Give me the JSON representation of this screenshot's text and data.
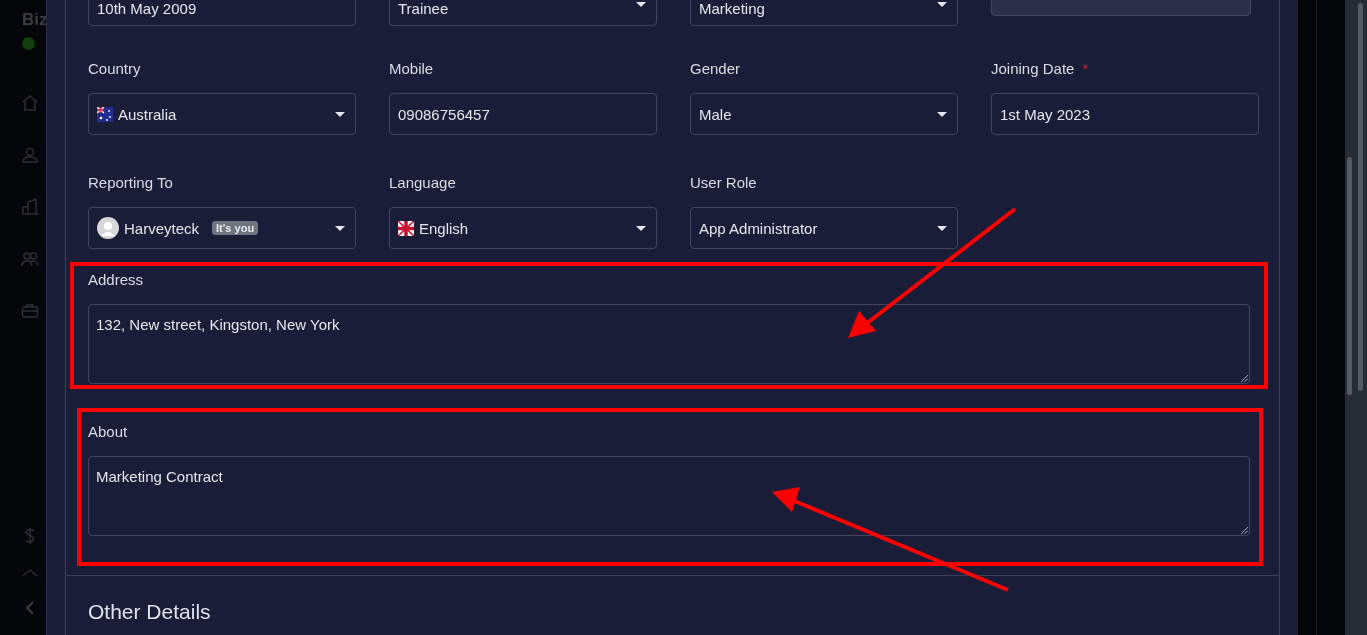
{
  "sidebar": {
    "brand": "Biz"
  },
  "top_row": [
    {
      "kind": "text",
      "value": "10th May 2009",
      "disabled": false
    },
    {
      "kind": "select",
      "value": "Trainee",
      "disabled": false
    },
    {
      "kind": "select",
      "value": "Marketing",
      "disabled": false
    },
    {
      "kind": "text",
      "disabled": true
    }
  ],
  "field_rows": [
    [
      {
        "label": "Country",
        "kind": "country",
        "value": "Australia"
      },
      {
        "label": "Mobile",
        "kind": "text",
        "value": "09086756457"
      },
      {
        "label": "Gender",
        "kind": "select",
        "value": "Male"
      },
      {
        "label": "Joining Date",
        "required_mark": "*",
        "kind": "text",
        "value": "1st May 2023"
      }
    ],
    [
      {
        "label": "Reporting To",
        "kind": "user",
        "value": "Harveyteck",
        "badge": "It's you"
      },
      {
        "label": "Language",
        "kind": "language",
        "value": "English"
      },
      {
        "label": "User Role",
        "kind": "select",
        "value": "App Administrator"
      }
    ]
  ],
  "text_areas": [
    {
      "label": "Address",
      "value": "132, New street, Kingston, New York"
    },
    {
      "label": "About",
      "value": "Marketing Contract"
    }
  ],
  "section_title": "Other Details"
}
